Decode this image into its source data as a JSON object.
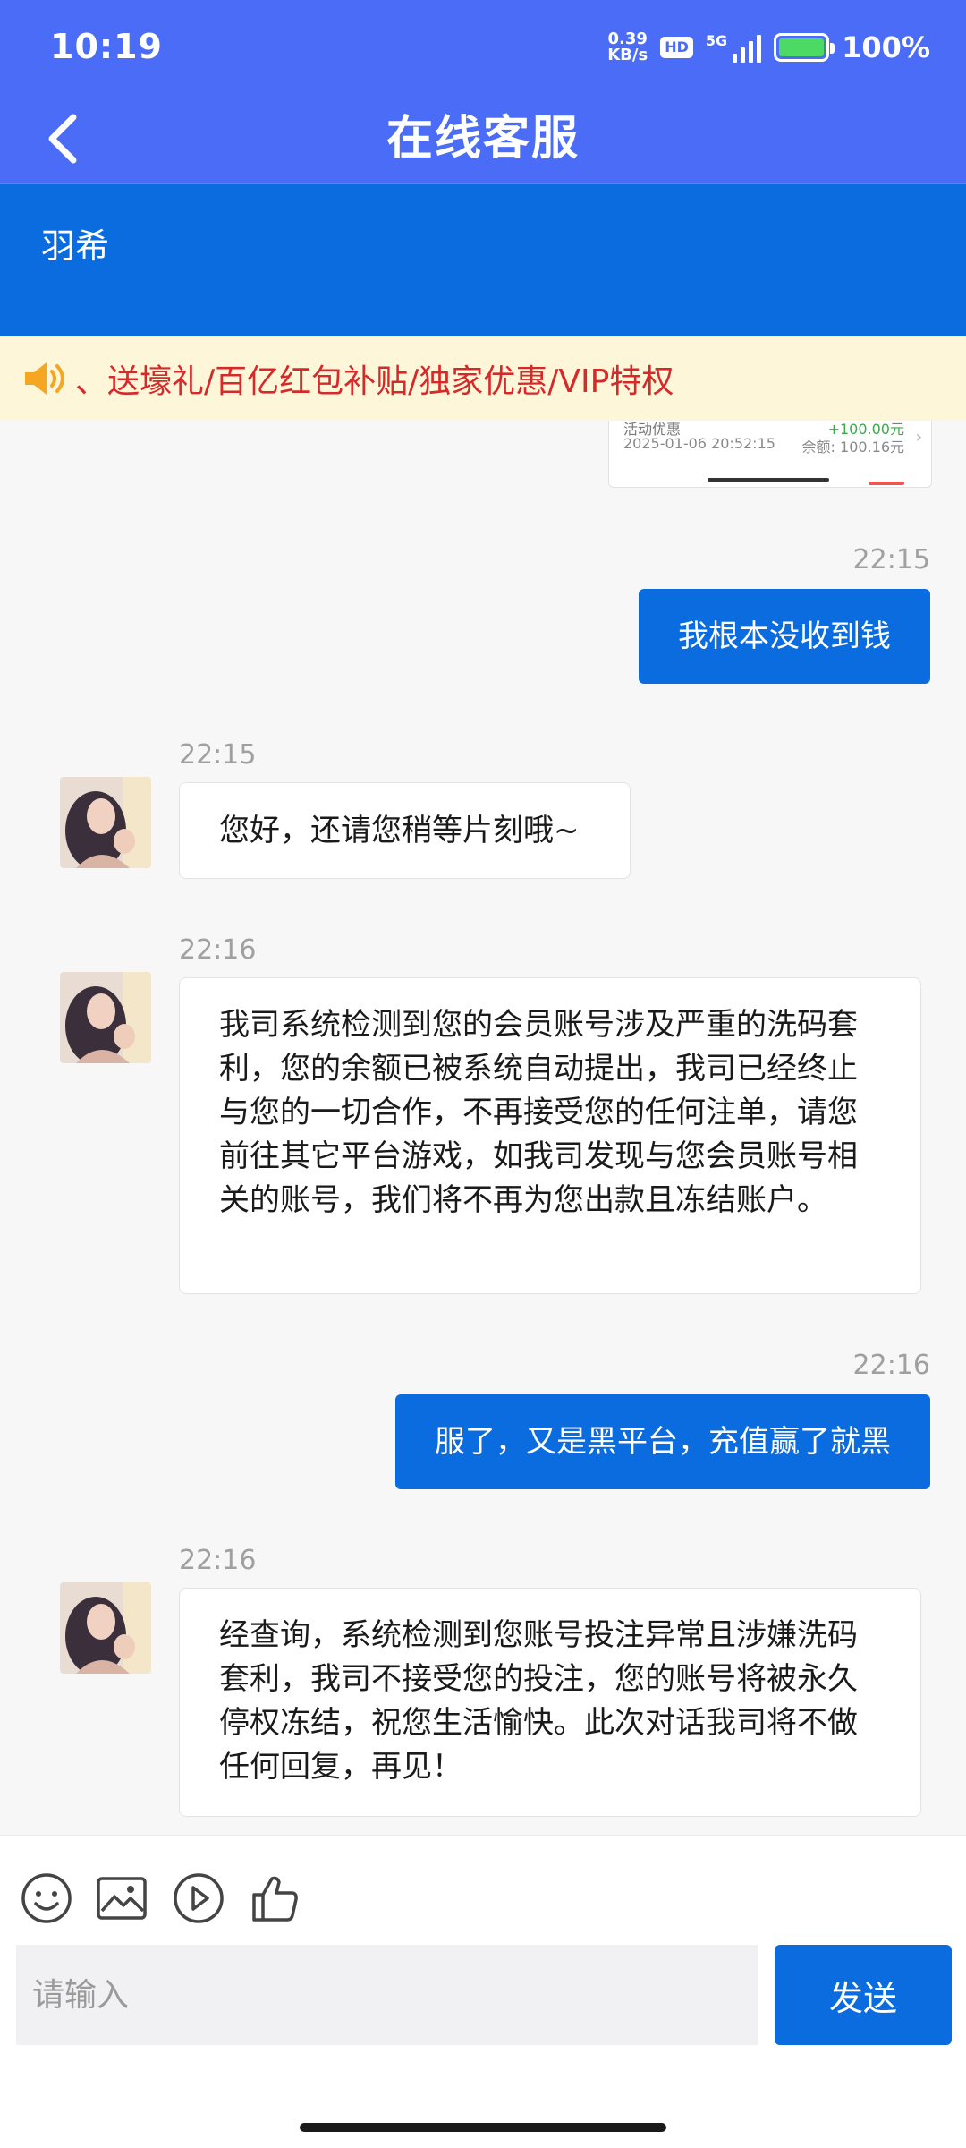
{
  "status_bar": {
    "time": "10:19",
    "net_speed_value": "0.39",
    "net_speed_unit": "KB/s",
    "hd": "HD",
    "network": "5G",
    "battery": "100%"
  },
  "header": {
    "title": "在线客服"
  },
  "agent": {
    "name": "羽希"
  },
  "notice": {
    "text": "、送壕礼/百亿红包补贴/独家优惠/VIP特权"
  },
  "image_fragment": {
    "label": "活动优惠",
    "amount": "+100.00元",
    "date": "2025-01-06 20:52:15",
    "balance": "余额: 100.16元"
  },
  "messages": [
    {
      "from": "me",
      "time": "22:15",
      "text": "我根本没收到钱"
    },
    {
      "from": "agent",
      "time": "22:15",
      "text": "您好，还请您稍等片刻哦~"
    },
    {
      "from": "agent",
      "time": "22:16",
      "text": "我司系统检测到您的会员账号涉及严重的洗码套利，您的余额已被系统自动提出，我司已经终止与您的一切合作，不再接受您的任何注单，请您前往其它平台游戏，如我司发现与您会员账号相关的账号，我们将不再为您出款且冻结账户。"
    },
    {
      "from": "me",
      "time": "22:16",
      "text": "服了，又是黑平台，充值赢了就黑"
    },
    {
      "from": "agent",
      "time": "22:16",
      "text": "经查询，系统检测到您账号投注异常且涉嫌洗码套利，我司不接受您的投注，您的账号将被永久停权冻结，祝您生活愉快。此次对话我司将不做任何回复，再见！"
    }
  ],
  "toolbar": {
    "icons": [
      "emoji-icon",
      "image-icon",
      "video-icon",
      "thumbs-up-icon"
    ]
  },
  "composer": {
    "placeholder": "请输入",
    "send_label": "发送"
  },
  "colors": {
    "header_bg": "#4a6cf7",
    "accent": "#0a6cdf",
    "notice_bg": "#fdf6d8",
    "notice_text": "#d62a2a"
  }
}
